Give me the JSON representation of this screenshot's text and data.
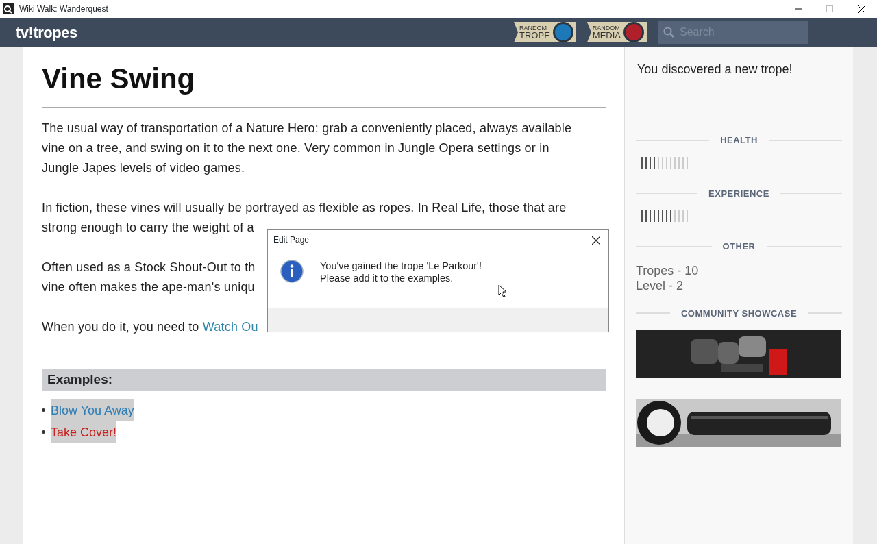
{
  "window": {
    "title": "Wiki Walk: Wanderquest"
  },
  "header": {
    "logo": "tv!tropes",
    "random_buttons": [
      {
        "line1": "RANDOM",
        "line2": "TROPE",
        "color": "#1d78b8"
      },
      {
        "line1": "RANDOM",
        "line2": "MEDIA",
        "color": "#b0202a"
      }
    ],
    "search": {
      "placeholder": "Search"
    }
  },
  "article": {
    "title": "Vine Swing",
    "paragraphs": [
      {
        "lines": [
          "The usual way of transportation of a Nature Hero: grab a conveniently placed, always available",
          "vine on a tree, and swing on it to the next one. Very common in Jungle Opera settings or in",
          "Jungle Japes levels of video games."
        ]
      },
      {
        "lines": [
          "In fiction, these vines will usually be portrayed as flexible as ropes. In Real Life, those that are",
          "strong enough to carry the weight of a"
        ]
      },
      {
        "lines": [
          "Often used as a Stock Shout-Out to th",
          "vine often makes the ape-man's uniqu"
        ]
      },
      {
        "lines": [
          "When you do it, you need to "
        ],
        "link": "Watch Ou"
      }
    ],
    "examples_heading": "Examples:",
    "examples": [
      {
        "label": "Blow You Away",
        "color": "#2e7db5"
      },
      {
        "label": "Take Cover!",
        "color": "#c8211e"
      }
    ]
  },
  "dialog": {
    "title": "Edit Page",
    "message_lines": [
      "You've gained the trope 'Le Parkour'!",
      "Please add it to the examples."
    ]
  },
  "sidebar": {
    "notice": "You discovered a new trope!",
    "meters": [
      {
        "heading": "HEALTH",
        "level": 0.333
      },
      {
        "heading": "EXPERIENCE",
        "level": 0.667
      }
    ],
    "other_heading": "OTHER",
    "stats": [
      "Tropes - 10",
      "Level - 2"
    ],
    "showcase_heading": "COMMUNITY SHOWCASE",
    "showcase": [
      {
        "kind": "picture"
      },
      {
        "kind": "picture"
      }
    ]
  }
}
